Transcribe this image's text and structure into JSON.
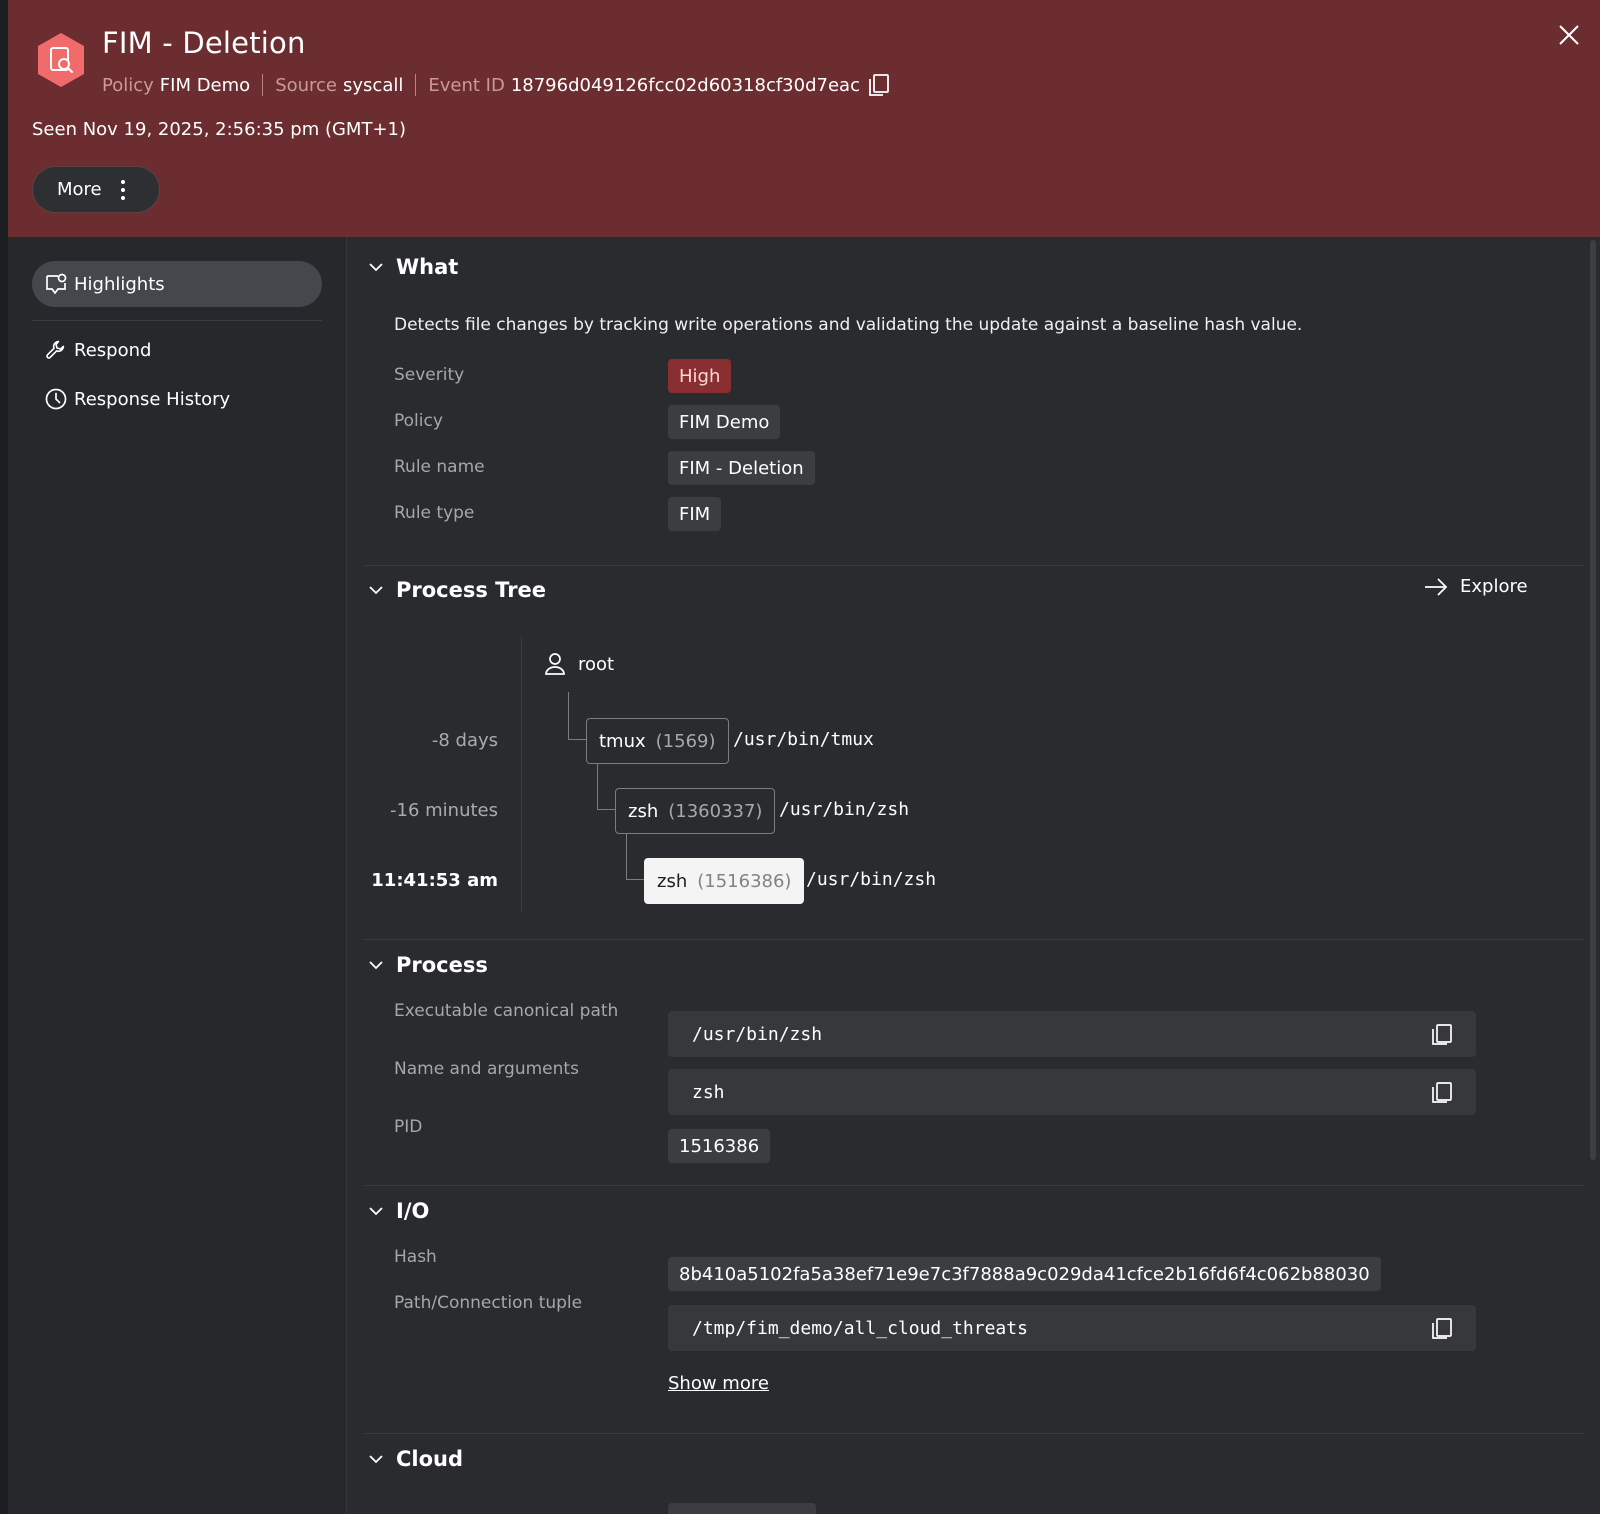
{
  "header": {
    "title": "FIM - Deletion",
    "meta": [
      {
        "key": "Policy",
        "value": "FIM Demo"
      },
      {
        "key": "Source",
        "value": "syscall"
      },
      {
        "key": "Event ID",
        "value": "18796d049126fcc02d60318cf30d7eac"
      }
    ],
    "seen": "Seen Nov 19, 2025, 2:56:35 pm (GMT+1)",
    "more_label": "More"
  },
  "sidebar": {
    "items": [
      {
        "label": "Highlights",
        "icon": "highlights-icon"
      },
      {
        "label": "Respond",
        "icon": "wrench-icon"
      },
      {
        "label": "Response History",
        "icon": "clock-icon"
      }
    ]
  },
  "what": {
    "heading": "What",
    "description": "Detects file changes by tracking write operations and validating the update against a baseline hash value.",
    "rows": [
      {
        "label": "Severity",
        "value": "High"
      },
      {
        "label": "Policy",
        "value": "FIM Demo"
      },
      {
        "label": "Rule name",
        "value": "FIM - Deletion"
      },
      {
        "label": "Rule type",
        "value": "FIM"
      }
    ]
  },
  "process_tree": {
    "heading": "Process Tree",
    "explore_label": "Explore",
    "root_user": "root",
    "nodes": [
      {
        "time": "-8 days",
        "name": "tmux",
        "pid": "(1569)",
        "path": "/usr/bin/tmux"
      },
      {
        "time": "-16 minutes",
        "name": "zsh",
        "pid": "(1360337)",
        "path": "/usr/bin/zsh"
      },
      {
        "time": "11:41:53 am",
        "name": "zsh",
        "pid": "(1516386)",
        "path": "/usr/bin/zsh"
      }
    ]
  },
  "process": {
    "heading": "Process",
    "rows": [
      {
        "label": "Executable canonical path",
        "value": "/usr/bin/zsh"
      },
      {
        "label": "Name and arguments",
        "value": "zsh"
      },
      {
        "label": "PID",
        "value": "1516386"
      }
    ]
  },
  "io": {
    "heading": "I/O",
    "rows": [
      {
        "label": "Hash",
        "value": "8b410a5102fa5a38ef71e9e7c3f7888a9c029da41cfce2b16fd6f4c062b88030"
      },
      {
        "label": "Path/Connection tuple",
        "value": "/tmp/fim_demo/all_cloud_threats"
      }
    ],
    "show_more": "Show more"
  },
  "cloud": {
    "heading": "Cloud"
  },
  "colors": {
    "header_bg": "#6b2d30",
    "severity_high_bg": "#8a2f31",
    "icon_accent": "#f26b6b"
  }
}
